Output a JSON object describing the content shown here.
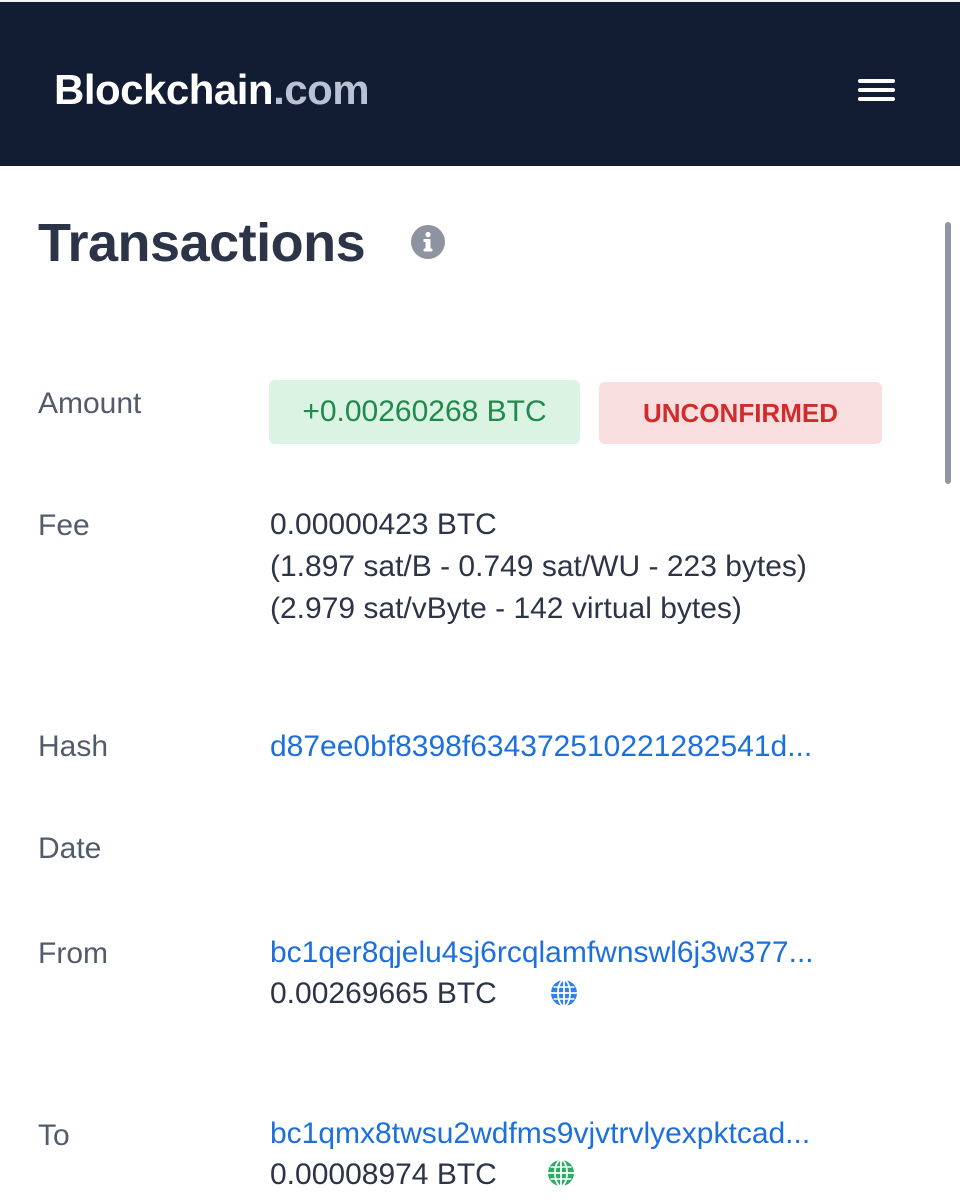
{
  "header": {
    "brand_main": "Blockchain",
    "brand_suffix": ".com",
    "menu_icon": "hamburger-menu-icon"
  },
  "colors": {
    "header_bg": "#121d33",
    "link": "#1c6fdc",
    "amount_green": "#1f8a4c",
    "amount_bg": "#dbf3e2",
    "unconfirmed_red": "#d02c2c",
    "unconfirmed_bg": "#f8dede",
    "globe_blue": "#2f80ed",
    "globe_green": "#27ae60"
  },
  "page": {
    "title": "Transactions",
    "title_icon": "info-icon"
  },
  "transaction": {
    "amount": {
      "label": "Amount",
      "value": "+0.00260268 BTC",
      "status": "UNCONFIRMED"
    },
    "fee": {
      "label": "Fee",
      "lines": [
        "0.00000423 BTC",
        "(1.897 sat/B - 0.749 sat/WU - 223 bytes)",
        "(2.979 sat/vByte - 142 virtual bytes)"
      ]
    },
    "hash": {
      "label": "Hash",
      "value": "d87ee0bf8398f634372510221282541d..."
    },
    "date": {
      "label": "Date",
      "value": ""
    },
    "from": {
      "label": "From",
      "address": "bc1qer8qjelu4sj6rcqlamfwnswl6j3w377...",
      "amount": "0.00269665 BTC",
      "icon": "globe-icon"
    },
    "to": {
      "label": "To",
      "address": "bc1qmx8twsu2wdfms9vjvtrvlyexpktcad...",
      "amount": "0.00008974 BTC",
      "icon": "globe-icon"
    }
  }
}
